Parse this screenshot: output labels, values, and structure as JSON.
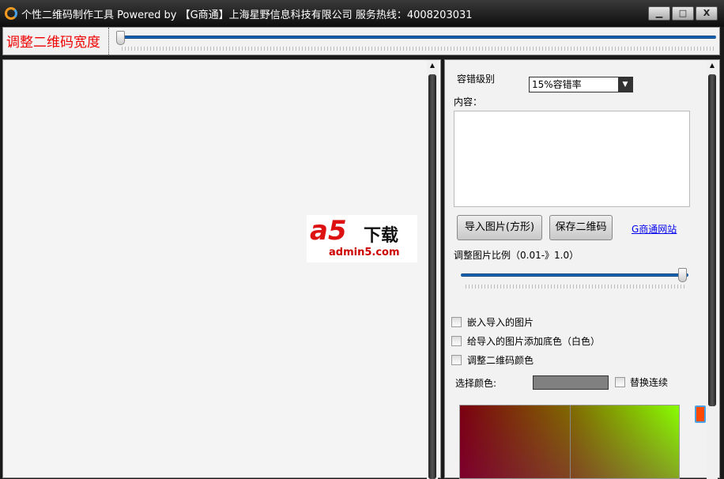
{
  "window": {
    "title": "个性二维码制作工具  Powered by 【G商通】上海星野信息科技有限公司 服务热线：4008203031",
    "minimize": "▁",
    "maximize": "□",
    "close": "X"
  },
  "width_slider": {
    "label": "调整二维码宽度",
    "value_fraction": 0.0
  },
  "watermark": {
    "logo": "a5",
    "text": "下载",
    "url": "admin5.com"
  },
  "panel": {
    "error_level_label": "容错级别",
    "error_level_value": "15%容错率",
    "content_label": "内容：",
    "content_value": "",
    "import_button": "导入图片(方形)",
    "save_button": "保存二维码",
    "site_link": "G商通网站",
    "ratio_label": "调整图片比例（0.01-》1.0）",
    "ratio_value": 1.0,
    "embed_checkbox": "嵌入导入的图片",
    "bg_checkbox": "给导入的图片添加底色（白色）",
    "color_checkbox": "调整二维码颜色",
    "select_color_label": "选择颜色:",
    "selected_color": "#808080",
    "replace_checkbox": "替换连续",
    "hue_color": "#ff4a00"
  }
}
